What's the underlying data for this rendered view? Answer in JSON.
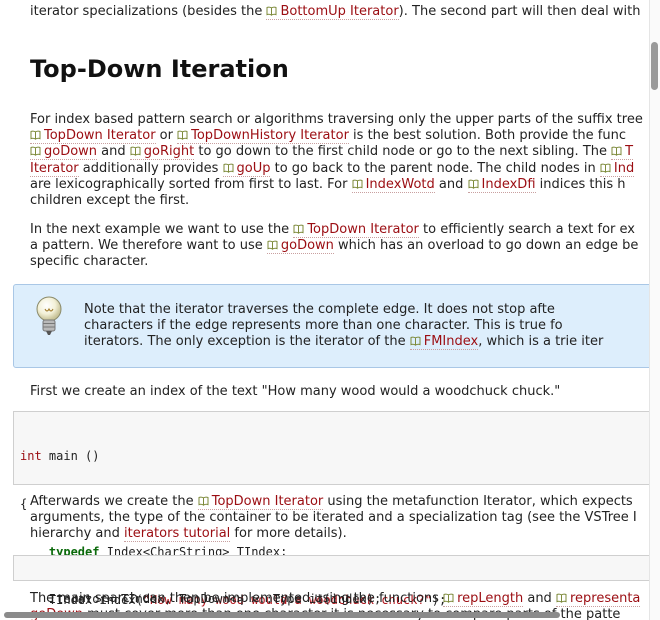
{
  "top_line": {
    "text1": "iterator specializations (besides the ",
    "link": "BottomUp Iterator",
    "text2": "). The second part will then deal with"
  },
  "heading": "Top-Down Iteration",
  "para1": {
    "l1": "For index based pattern search or algorithms traversing only the upper parts of the suffix tree",
    "l2_link1": "TopDown Iterator",
    "l2_t1": " or ",
    "l2_link2": "TopDownHistory Iterator",
    "l2_t2": " is the best solution. Both provide the func",
    "l3_link1": "goDown",
    "l3_t1": " and ",
    "l3_link2": "goRight",
    "l3_t2": " to go down to the first child node or go to the next sibling. The ",
    "l3_link3": "T",
    "l4_link1": "Iterator",
    "l4_t1": " additionally provides ",
    "l4_link2": "goUp",
    "l4_t2": " to go back to the parent node. The child nodes in ",
    "l4_link3": "Ind",
    "l5_t1": "are lexicographically sorted from first to last. For ",
    "l5_link1": "IndexWotd",
    "l5_t2": " and ",
    "l5_link2": "IndexDfi",
    "l5_t3": " indices this h",
    "l6": "children except the first."
  },
  "para2": {
    "l1_t1": "In the next example we want to use the ",
    "l1_link": "TopDown Iterator",
    "l1_t2": " to efficiently search a text for ex",
    "l2_t1": "a pattern. We therefore want to use ",
    "l2_link": "goDown",
    "l2_t2": " which has an overload to go down an edge be",
    "l3": "specific character."
  },
  "note": {
    "l1": "Note that the iterator traverses the complete edge. It does not stop afte",
    "l2": "characters if the edge represents more than one character. This is true fo",
    "l3_t1": "iterators. The only exception is the iterator of the ",
    "l3_link": "FMIndex",
    "l3_t2": ", which is a trie iter"
  },
  "para3": "First we create an index of the text \"How many wood would a woodchuck chuck.\"",
  "code1": {
    "l1_kw": "int",
    "l1_t": " main ()",
    "l2": "{",
    "l3_kw": "typedef",
    "l3_t": " Index<CharString> TIndex;",
    "l4_t1": "    TIndex index(",
    "l4_str": "\"How many wood would a woodchuck chuck?\"",
    "l4_t2": ");"
  },
  "para4": {
    "l1_t1": "Afterwards we create the ",
    "l1_link": "TopDown Iterator",
    "l1_t2": " using the metafunction Iterator, which expects",
    "l2": "arguments, the type of the container to be iterated and a specialization tag (see the VSTree I",
    "l3_t1": "hierarchy and ",
    "l3_link": "iterators tutorial",
    "l3_t2": " for more details)."
  },
  "code2": {
    "l1": "    Iterator< TIndex, TopDown<> >::Type it(index);"
  },
  "para5": {
    "l1_t1": "The main search can then be implemented using the functions ",
    "l1_link1": "repLength",
    "l1_t2": " and ",
    "l1_link2": "representa",
    "l2_t1": "goDown",
    "l2_t2": " must cover more than one character it is necessary to compare parts of the patte"
  }
}
